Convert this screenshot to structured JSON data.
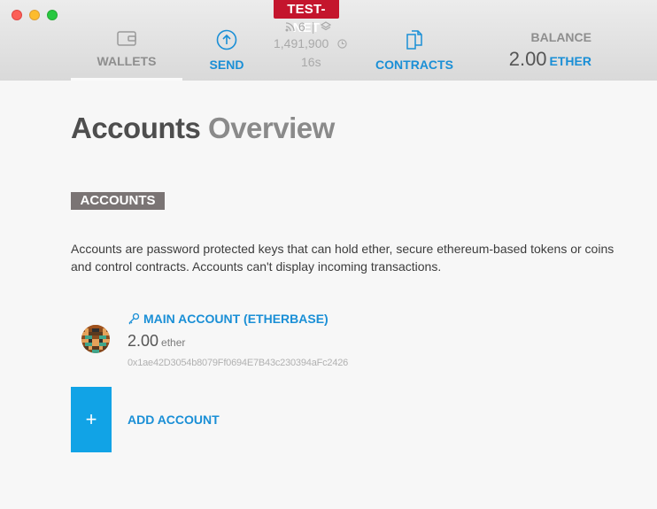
{
  "header": {
    "network_badge": "TEST-NET",
    "nav": {
      "wallets_label": "WALLETS",
      "send_label": "SEND",
      "contracts_label": "CONTRACTS"
    },
    "status": {
      "peers": "6",
      "block_number": "1,491,900",
      "block_time": "16s"
    },
    "balance": {
      "label": "BALANCE",
      "value": "2.00",
      "unit": "ETHER"
    }
  },
  "main": {
    "title_bold": "Accounts",
    "title_light": "Overview",
    "section_label": "ACCOUNTS",
    "description": "Accounts are password protected keys that can hold ether, secure ethereum-based tokens or coins and control contracts. Accounts can't display incoming transactions.",
    "accounts": [
      {
        "name": "MAIN ACCOUNT (ETHERBASE)",
        "balance": "2.00",
        "unit": "ether",
        "address": "0x1ae42D3054b8079Ff0694E7B43c230394aFc2426"
      }
    ],
    "add_account": {
      "icon_label": "+",
      "label": "ADD ACCOUNT"
    }
  },
  "colors": {
    "accent": "#1a8fd6",
    "testnet": "#c4152d",
    "add_button": "#11a3e6"
  }
}
